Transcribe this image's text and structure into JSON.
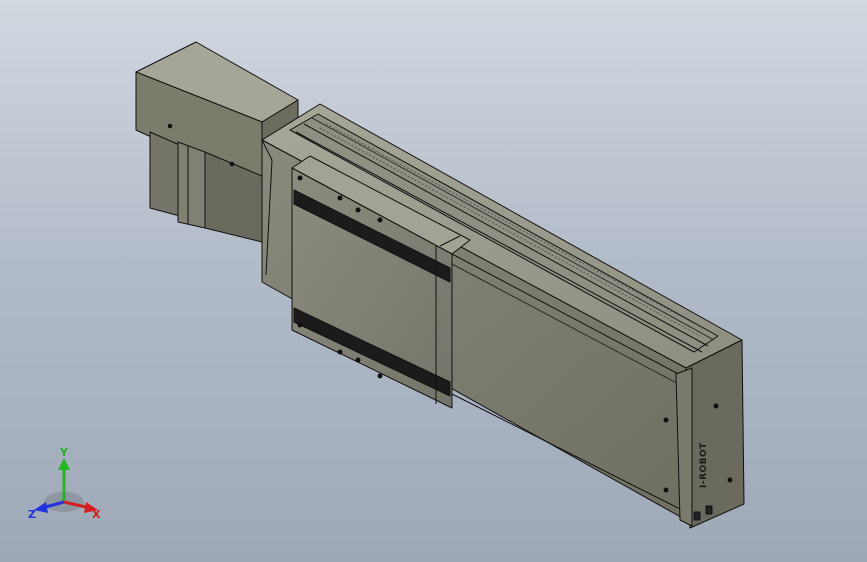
{
  "viewport": {
    "brand_mark": "I-ROBOT"
  },
  "triad": {
    "x_label": "X",
    "y_label": "Y",
    "z_label": "Z",
    "x_color": "#d42020",
    "y_color": "#1fb81f",
    "z_color": "#2233e0"
  },
  "colors": {
    "body_face": "#7e7e6e",
    "body_top": "#9d9d90",
    "edge": "#101010",
    "end_cap": "#6a6a5e"
  }
}
